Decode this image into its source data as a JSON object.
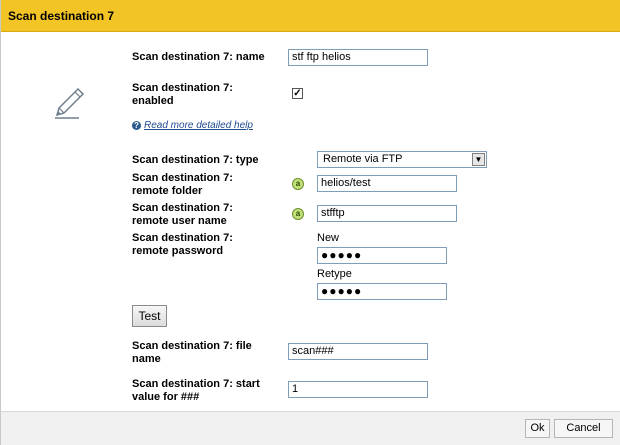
{
  "dialog": {
    "title": "Scan destination 7",
    "accent_color": "#f3c425",
    "icon": "pencil-icon"
  },
  "fields": {
    "name_label": "Scan destination 7: name",
    "name_value": "stf ftp helios",
    "enabled_label_1": "Scan destination 7:",
    "enabled_label_2": "enabled",
    "enabled_checked": "✓",
    "help_link": "Read more detailed help",
    "type_label": "Scan destination 7: type",
    "type_value": "Remote via FTP",
    "folder_label_1": "Scan destination 7:",
    "folder_label_2": "remote folder",
    "folder_value": "helios/test",
    "user_label_1": "Scan destination 7:",
    "user_label_2": "remote user name",
    "user_value": "stfftp",
    "password_label_1": "Scan destination 7:",
    "password_label_2": "remote password",
    "password_new_label": "New",
    "password_new_value": "●●●●●",
    "password_retype_label": "Retype",
    "password_retype_value": "●●●●●",
    "test_button": "Test",
    "file_label_1": "Scan destination 7: file",
    "file_label_2": "name",
    "file_value": "scan###",
    "start_label_1": "Scan destination 7: start",
    "start_label_2": "value for ###",
    "start_value": "1"
  },
  "footer": {
    "ok_button": "Ok",
    "cancel_button": "Cancel"
  }
}
